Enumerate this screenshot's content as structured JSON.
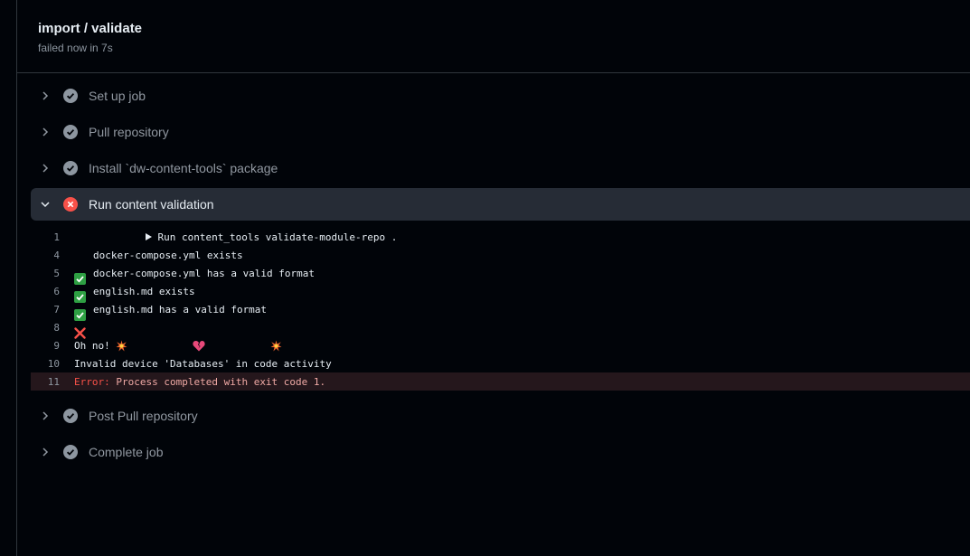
{
  "job": {
    "title": "import / validate",
    "subtitle": "failed now in 7s"
  },
  "steps_before": [
    {
      "label": "Set up job",
      "status": "success"
    },
    {
      "label": "Pull repository",
      "status": "success"
    },
    {
      "label": "Install `dw-content-tools` package",
      "status": "success"
    }
  ],
  "active_step": {
    "label": "Run content validation",
    "status": "failure"
  },
  "log": {
    "lines": [
      {
        "num": "1",
        "text": "Run content_tools validate-module-repo ."
      },
      {
        "num": "4",
        "text": "docker-compose.yml exists"
      },
      {
        "num": "5",
        "text": "docker-compose.yml has a valid format"
      },
      {
        "num": "6",
        "text": "english.md exists"
      },
      {
        "num": "7",
        "text": "english.md has a valid format"
      },
      {
        "num": "8",
        "text": ""
      },
      {
        "num": "9",
        "text": "Oh no!"
      },
      {
        "num": "10",
        "text": "Invalid device 'Databases' in code activity"
      },
      {
        "num": "11",
        "error_keyword": "Error:",
        "text": " Process completed with exit code 1."
      }
    ]
  },
  "steps_after": [
    {
      "label": "Post Pull repository",
      "status": "success"
    },
    {
      "label": "Complete job",
      "status": "success"
    }
  ],
  "colors": {
    "success_icon": "#8d96a0",
    "failure_icon": "#f85149",
    "check_badge": "#2ea043",
    "cross_badge": "#f85149"
  }
}
